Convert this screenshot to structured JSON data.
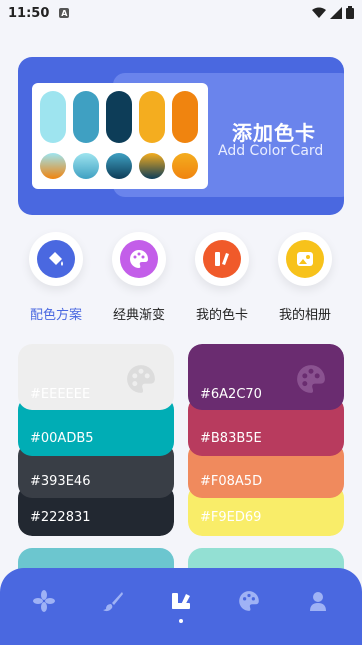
{
  "status": {
    "time": "11:50"
  },
  "banner": {
    "title": "添加色卡",
    "subtitle": "Add Color Card",
    "pills": [
      "#9ee4ef",
      "#3fa0c2",
      "#0d3d58",
      "#f4ad1f",
      "#f0840f"
    ]
  },
  "quick_nav": [
    {
      "label": "配色方案",
      "active": true,
      "color": "#4a68e0"
    },
    {
      "label": "经典渐变",
      "active": false,
      "color": "#c35ee9"
    },
    {
      "label": "我的色卡",
      "active": false,
      "color": "#f05a2a"
    },
    {
      "label": "我的相册",
      "active": false,
      "color": "#f7c21b"
    }
  ],
  "palette_cards": [
    {
      "colors": [
        {
          "hex": "#EEEEEE",
          "label": "#EEEEEE"
        },
        {
          "hex": "#00ADB5",
          "label": "#00ADB5"
        },
        {
          "hex": "#393E46",
          "label": "#393E46"
        },
        {
          "hex": "#222831",
          "label": "#222831"
        }
      ]
    },
    {
      "colors": [
        {
          "hex": "#6A2C70",
          "label": "#6A2C70"
        },
        {
          "hex": "#B83B5E",
          "label": "#B83B5E"
        },
        {
          "hex": "#F08A5D",
          "label": "#F08A5D"
        },
        {
          "hex": "#F9ED69",
          "label": "#F9ED69"
        }
      ]
    }
  ],
  "tabs": [
    "flower-icon",
    "brush-icon",
    "palette-swatch-icon",
    "palette-icon",
    "user-icon"
  ],
  "active_tab": 2
}
